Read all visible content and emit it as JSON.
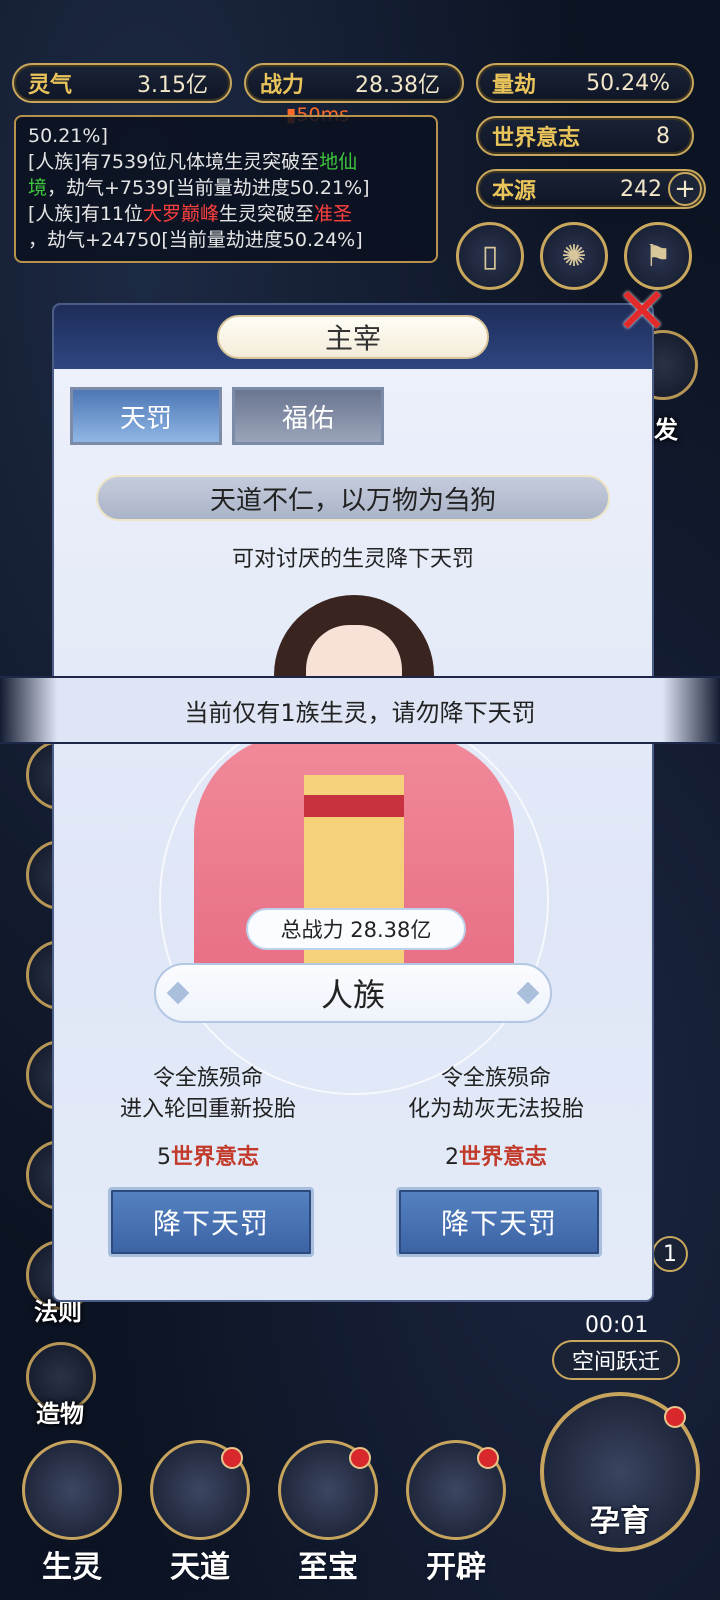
{
  "stats": {
    "lingqi": {
      "label": "灵气",
      "value": "3.15亿"
    },
    "zhanli": {
      "label": "战力",
      "value": "28.38亿"
    },
    "liangjie": {
      "label": "量劫",
      "value": "50.24%"
    },
    "world_will": {
      "label": "世界意志",
      "value": "8"
    },
    "benyuan": {
      "label": "本源",
      "value": "242"
    }
  },
  "ping": "50ms",
  "log": {
    "line0": "50.21%]",
    "line1_a": "[人族]有7539位凡体境生灵突破至",
    "line1_b": "地仙",
    "line1_c": "境",
    "line1_d": "，劫气+7539[当前量劫进度50.21%]",
    "line2_a": "[人族]有11位",
    "line2_b": "大罗巅峰",
    "line2_c": "生灵突破至",
    "line2_d": "准圣",
    "line2_e": "，劫气+24750[当前量劫进度50.24%]"
  },
  "side_labels": {
    "right_burst": "爆发",
    "left_fa": "法则",
    "left_zao": "造物",
    "right_jump": "空间跃迁",
    "timer": "00:01",
    "right_badge": "1"
  },
  "modal": {
    "title": "主宰",
    "tabs": [
      "天罚",
      "福佑"
    ],
    "motto": "天道不仁，以万物为刍狗",
    "subtitle": "可对讨厌的生灵降下天罚",
    "notice": "当前仅有1族生灵，请勿降下天罚",
    "total_power": "总战力 28.38亿",
    "race": "人族",
    "options": [
      {
        "line1": "令全族殒命",
        "line2": "进入轮回重新投胎",
        "cost_num": "5",
        "cost_unit": "世界意志",
        "button": "降下天罚"
      },
      {
        "line1": "令全族殒命",
        "line2": "化为劫灰无法投胎",
        "cost_num": "2",
        "cost_unit": "世界意志",
        "button": "降下天罚"
      }
    ]
  },
  "bottom_nav": [
    "生灵",
    "天道",
    "至宝",
    "开辟",
    "孕育"
  ]
}
